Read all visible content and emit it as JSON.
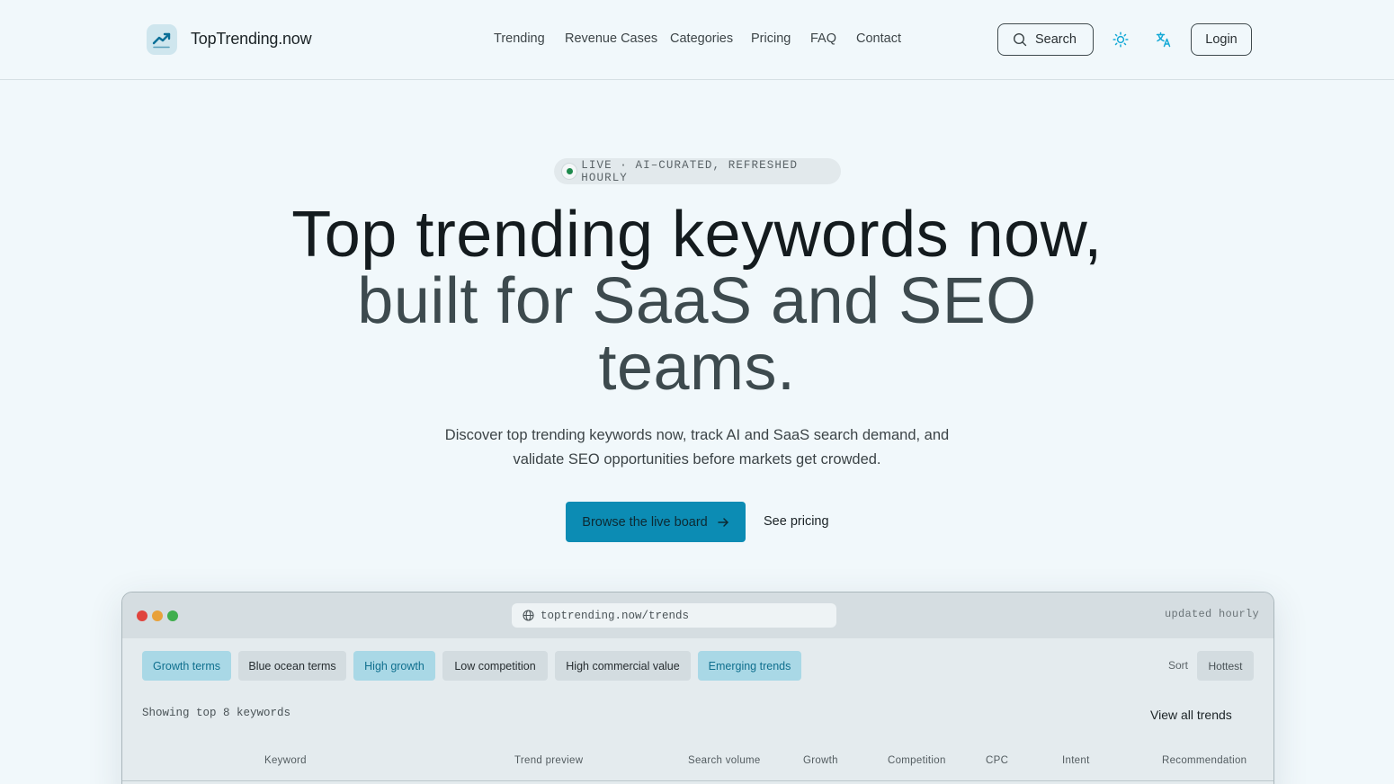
{
  "header": {
    "brand": "TopTrending.now",
    "nav": [
      "Trending",
      "Revenue Cases",
      "Categories",
      "Pricing",
      "FAQ",
      "Contact"
    ],
    "search_label": "Search",
    "login_label": "Login"
  },
  "hero": {
    "badge": "LIVE · AI–CURATED, REFRESHED HOURLY",
    "title_line1": "Top trending keywords now,",
    "title_line2": "built for SaaS and SEO",
    "title_line3": "teams.",
    "subtitle": "Discover top trending keywords now, track AI and SaaS search demand, and validate SEO opportunities before markets get crowded.",
    "cta_primary": "Browse the live board",
    "cta_secondary": "See pricing"
  },
  "preview": {
    "url": "toptrending.now/trends",
    "updated": "updated hourly",
    "filters": [
      {
        "label": "Growth terms",
        "active": true
      },
      {
        "label": "Blue ocean terms",
        "active": false
      },
      {
        "label": "High growth",
        "active": true
      },
      {
        "label": "Low competition",
        "active": false
      },
      {
        "label": "High commercial value",
        "active": false
      },
      {
        "label": "Emerging trends",
        "active": true
      }
    ],
    "sort_label": "Sort",
    "sort_value": "Hottest",
    "showing": "Showing top 8 keywords",
    "view_all": "View all trends",
    "columns": [
      "Keyword",
      "Trend preview",
      "Search volume",
      "Growth",
      "Competition",
      "CPC",
      "Intent",
      "Recommendation"
    ]
  },
  "colors": {
    "accent": "#0c8cb4",
    "chip_active_bg": "#a9d8e6",
    "chip_active_text": "#0f6f8e",
    "live_dot": "#1e8a4c",
    "icon_accent": "#15a9d6"
  },
  "icons": {
    "logo": "trending-up-icon",
    "search": "search-icon",
    "theme": "sun-icon",
    "language": "translate-icon",
    "cta_arrow": "arrow-right-icon",
    "url": "globe-icon"
  }
}
